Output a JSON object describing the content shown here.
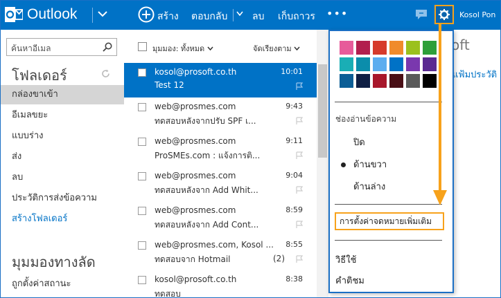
{
  "header": {
    "brand": "Outlook",
    "new_label": "สร้าง",
    "reply_label": "ตอบกลับ",
    "delete_label": "ลบ",
    "archive_label": "เก็บถาวร",
    "more_label": "•••",
    "user_name": "Kosol Pon"
  },
  "sidebar": {
    "search_placeholder": "ค้นหาอีเมล",
    "folders_title": "โฟลเดอร์",
    "folders": [
      {
        "label": "กล่องขาเข้า"
      },
      {
        "label": "อีเมลขยะ"
      },
      {
        "label": "แบบร่าง"
      },
      {
        "label": "ส่ง"
      },
      {
        "label": "ลบ"
      },
      {
        "label": "ประวัติการส่งข้อความ"
      },
      {
        "label": "สร้างโฟลเดอร์"
      }
    ],
    "shortcuts_title": "มุมมองทางลัด",
    "shortcut_item": "ถูกตั้งค่าสถานะ"
  },
  "list": {
    "view_label": "มุมมอง: ทั้งหมด",
    "sort_label": "จัดเรียงตาม",
    "messages": [
      {
        "from": "kosol@prosoft.co.th",
        "time": "10:01",
        "subject": "Test 12",
        "count": ""
      },
      {
        "from": "web@prosmes.com",
        "time": "9:43",
        "subject": "ทดสอบหลังจากปรับ SPF เ...",
        "count": ""
      },
      {
        "from": "web@prosmes.com",
        "time": "9:11",
        "subject": "ProSMEs.com : แจ้งการติ...",
        "count": ""
      },
      {
        "from": "web@prosmes.com",
        "time": "9:04",
        "subject": "ทดสอบหลังจาก Add Whit...",
        "count": ""
      },
      {
        "from": "web@prosmes.com",
        "time": "8:59",
        "subject": "ทดสอบหลังจาก Add Cont...",
        "count": ""
      },
      {
        "from": "web@prosmes.com, Kosol ...",
        "time": "8:55",
        "subject": "ทดสอบจาก Hotmail",
        "count": "(2)"
      },
      {
        "from": "kosol@prosoft.co.th",
        "time": "8:38",
        "subject": "ทดสอบ",
        "count": ""
      }
    ]
  },
  "reading": {
    "brand_fragment": "oft",
    "link_fragment": "แฟ้มประวัติ"
  },
  "settings_menu": {
    "swatch_colors": [
      "#e75b9a",
      "#b21f4e",
      "#d63a2b",
      "#f08b2b",
      "#9bc11d",
      "#2e9f3a",
      "#1aaeb5",
      "#0b8dab",
      "#5cadef",
      "#0072c6",
      "#7a38ae",
      "#5a2a91",
      "#0c5e96",
      "#0f1f44",
      "#a8172b",
      "#4a0f16",
      "#5a5a5a",
      "#000000"
    ],
    "reading_pane_heading": "ช่องอ่านข้อความ",
    "reading_pane_off": "ปิด",
    "reading_pane_right": "ด้านขวา",
    "reading_pane_bottom": "ด้านล่าง",
    "more_mail_settings": "การตั้งค่าจดหมายเพิ่มเติม",
    "help": "วิธีใช้",
    "feedback": "คำติชม"
  },
  "colors": {
    "brand_blue": "#0072c6",
    "highlight_orange": "#f7a21b"
  }
}
